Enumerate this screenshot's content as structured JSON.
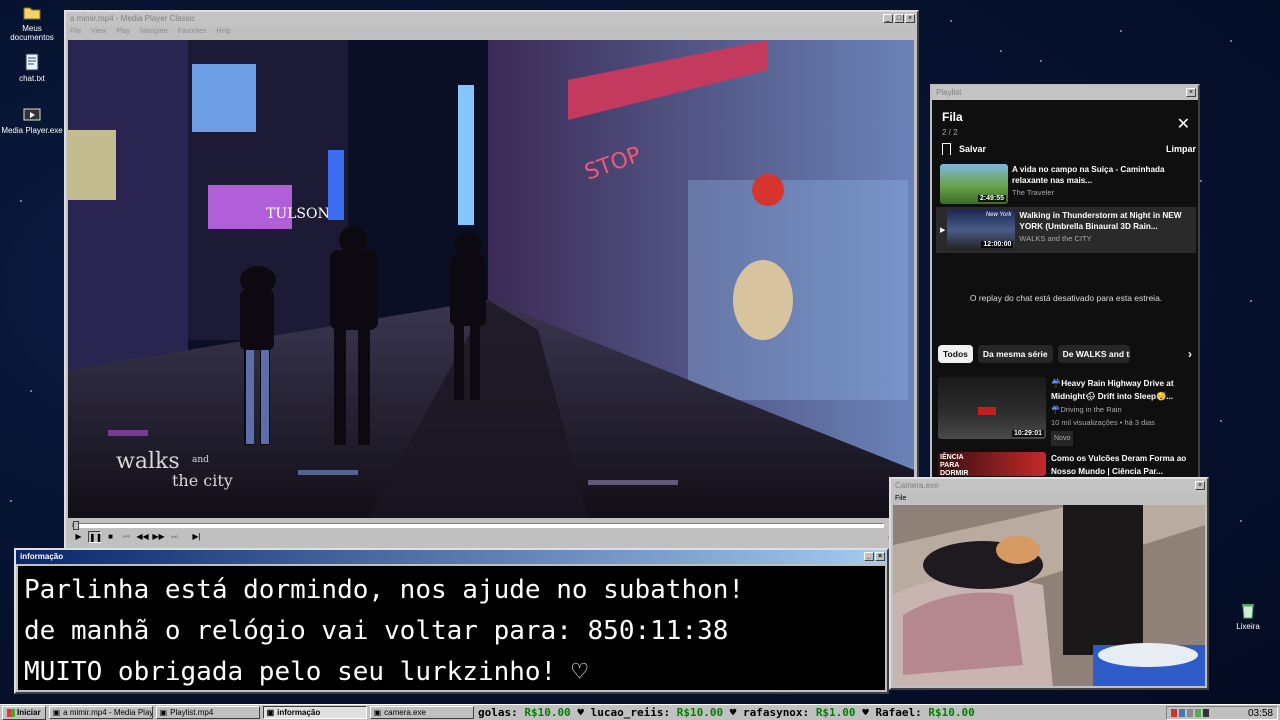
{
  "desktop": {
    "icons": [
      {
        "label": "Meus documentos",
        "icon": "folder-icon"
      },
      {
        "label": "chat.txt",
        "icon": "notepad-icon"
      },
      {
        "label": "Media Player.exe",
        "icon": "media-player-icon"
      },
      {
        "label": "Lixeira",
        "icon": "recycle-bin-icon"
      }
    ]
  },
  "mpc": {
    "title": "a mimir.mp4 - Media Player Classic",
    "menu": [
      "File",
      "View",
      "Play",
      "Navigate",
      "Favorites",
      "Help"
    ],
    "watermark_line1": "walks",
    "watermark_and": "and",
    "watermark_line2": "the city",
    "sign_text": "TULSON",
    "sign_stop": "STOP",
    "seek_position": 0.0,
    "controls": [
      "play",
      "pause",
      "stop",
      "prev",
      "rewind",
      "forward",
      "next",
      "frame-step"
    ],
    "volume_icon": "speaker-icon"
  },
  "playlist": {
    "title": "Playlist",
    "header": "Fila",
    "count": "2 / 2",
    "save": "Salvar",
    "clear": "Limpar",
    "queue": [
      {
        "title": "A vida no campo na Suíça - Caminhada relaxante nas mais...",
        "channel": "The Traveler",
        "duration": "2:49:55"
      },
      {
        "title": "Walking in Thunderstorm at Night in NEW YORK (Umbrella Binaural 3D Rain...",
        "channel": "WALKS and the CITY",
        "duration": "12:00:00",
        "thumb_text": "New York"
      }
    ],
    "replay_msg": "O replay do chat está desativado para esta estreia.",
    "chips": [
      "Todos",
      "Da mesma série",
      "De WALKS and the CI"
    ],
    "recommendations": [
      {
        "title": "☔Heavy Rain Highway Drive at Midnight🌧 Drift into Sleep😴...",
        "channel": "☔Driving in the Rain",
        "meta": "10 mil visualizações • há 3 dias",
        "badge": "Novo",
        "duration": "10:29:01"
      },
      {
        "title": "Como os Vulcões Deram Forma ao Nosso Mundo | Ciência Par...",
        "thumb_text": "IÊNCIA PARA DORMIR"
      }
    ]
  },
  "info": {
    "title": "informação",
    "line1": "Parlinha está dormindo, nos ajude no subathon!",
    "line2": "de manhã o relógio vai voltar para:  850:11:38",
    "line3": "MUITO obrigada pelo seu lurkzinho! ♡"
  },
  "camera": {
    "title": "Camera.exe",
    "menu": "File"
  },
  "taskbar": {
    "start": "Iniciar",
    "tasks": [
      "a mimir.mp4 - Media Playe...",
      "Playlist.mp4",
      "informação",
      "camera.exe"
    ],
    "ticker": [
      {
        "name": "golas:",
        "amount": "R$10.00"
      },
      {
        "name": "lucao_reiis:",
        "amount": "R$10.00"
      },
      {
        "name": "rafasynox:",
        "amount": "R$1.00"
      },
      {
        "name": "Rafael:",
        "amount": "R$10.00"
      }
    ],
    "clock": "03:58"
  },
  "colors": {
    "title_active": "#0a246a",
    "ticker_amount": "#008000",
    "yt_bg": "#0f0f0f"
  }
}
